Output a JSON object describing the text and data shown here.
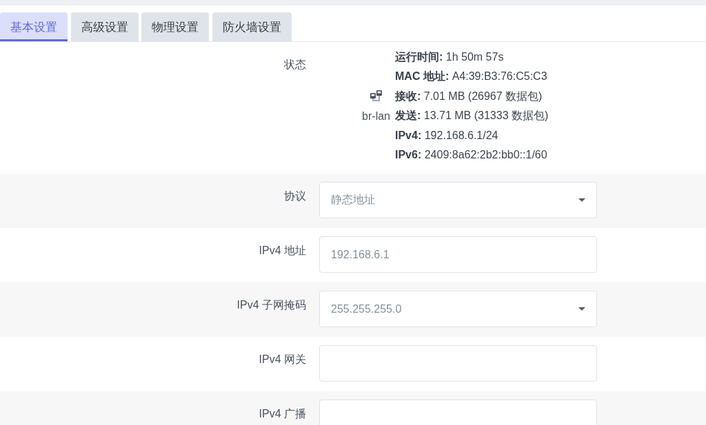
{
  "tabs": [
    {
      "label": "基本设置",
      "selected": true
    },
    {
      "label": "高级设置",
      "selected": false
    },
    {
      "label": "物理设置",
      "selected": false
    },
    {
      "label": "防火墙设置",
      "selected": false
    }
  ],
  "status": {
    "label": "状态",
    "interface": "br-lan",
    "lines": [
      "**运行时间:** 1h 50m 57s",
      "**MAC 地址:** A4:39:B3:76:C5:C3",
      "**接收:** 7.01 MB (26967 数据包)",
      "**发送:** 13.71 MB (31333 数据包)",
      "**IPv4:** 192.168.6.1/24",
      "**IPv6:** 2409:8a62:2b2:bb0::1/60"
    ]
  },
  "fields": [
    {
      "label": "协议",
      "kind": "select",
      "value": "静态地址"
    },
    {
      "label": "IPv4 地址",
      "kind": "input",
      "value": "192.168.6.1"
    },
    {
      "label": "IPv4 子网掩码",
      "kind": "select",
      "value": "255.255.255.0"
    },
    {
      "label": "IPv4 网关",
      "kind": "input"
    },
    {
      "label": "IPv4 广播",
      "kind": "input"
    }
  ]
}
